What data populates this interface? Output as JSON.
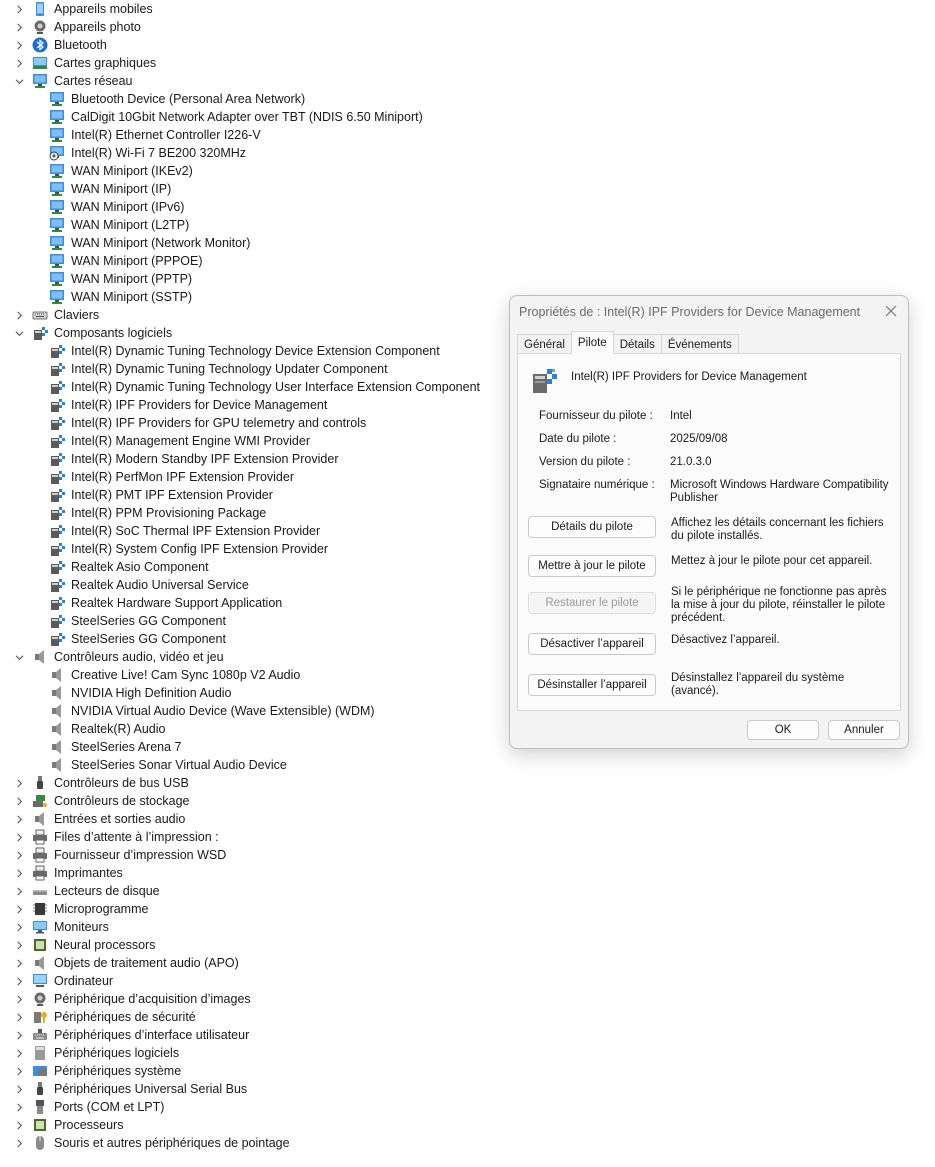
{
  "tree": [
    {
      "kind": "cat",
      "label": "Appareils mobiles",
      "icon": "mobile-icon",
      "expanded": false
    },
    {
      "kind": "cat",
      "label": "Appareils photo",
      "icon": "camera-icon",
      "expanded": false
    },
    {
      "kind": "cat",
      "label": "Bluetooth",
      "icon": "bluetooth-icon",
      "expanded": false
    },
    {
      "kind": "cat",
      "label": "Cartes graphiques",
      "icon": "display-adapter-icon",
      "expanded": false
    },
    {
      "kind": "cat",
      "label": "Cartes réseau",
      "icon": "network-icon",
      "expanded": true
    },
    {
      "kind": "child",
      "label": "Bluetooth Device (Personal Area Network)",
      "icon": "network-icon"
    },
    {
      "kind": "child",
      "label": "CalDigit 10Gbit Network Adapter over TBT (NDIS 6.50 Miniport)",
      "icon": "network-icon"
    },
    {
      "kind": "child",
      "label": "Intel(R) Ethernet Controller I226-V",
      "icon": "network-icon"
    },
    {
      "kind": "child",
      "label": "Intel(R) Wi-Fi 7 BE200 320MHz",
      "icon": "network-disabled-icon"
    },
    {
      "kind": "child",
      "label": "WAN Miniport (IKEv2)",
      "icon": "network-icon"
    },
    {
      "kind": "child",
      "label": "WAN Miniport (IP)",
      "icon": "network-icon"
    },
    {
      "kind": "child",
      "label": "WAN Miniport (IPv6)",
      "icon": "network-icon"
    },
    {
      "kind": "child",
      "label": "WAN Miniport (L2TP)",
      "icon": "network-icon"
    },
    {
      "kind": "child",
      "label": "WAN Miniport (Network Monitor)",
      "icon": "network-icon"
    },
    {
      "kind": "child",
      "label": "WAN Miniport (PPPOE)",
      "icon": "network-icon"
    },
    {
      "kind": "child",
      "label": "WAN Miniport (PPTP)",
      "icon": "network-icon"
    },
    {
      "kind": "child",
      "label": "WAN Miniport (SSTP)",
      "icon": "network-icon"
    },
    {
      "kind": "cat",
      "label": "Claviers",
      "icon": "keyboard-icon",
      "expanded": false
    },
    {
      "kind": "cat",
      "label": "Composants logiciels",
      "icon": "software-component-icon",
      "expanded": true
    },
    {
      "kind": "child",
      "label": "Intel(R) Dynamic Tuning Technology Device Extension Component",
      "icon": "software-component-icon"
    },
    {
      "kind": "child",
      "label": "Intel(R) Dynamic Tuning Technology Updater Component",
      "icon": "software-component-icon"
    },
    {
      "kind": "child",
      "label": "Intel(R) Dynamic Tuning Technology User Interface Extension Component",
      "icon": "software-component-icon"
    },
    {
      "kind": "child",
      "label": "Intel(R) IPF Providers for Device Management",
      "icon": "software-component-icon"
    },
    {
      "kind": "child",
      "label": "Intel(R) IPF Providers for GPU telemetry and controls",
      "icon": "software-component-icon"
    },
    {
      "kind": "child",
      "label": "Intel(R) Management Engine WMI Provider",
      "icon": "software-component-icon"
    },
    {
      "kind": "child",
      "label": "Intel(R) Modern Standby IPF Extension Provider",
      "icon": "software-component-icon"
    },
    {
      "kind": "child",
      "label": "Intel(R) PerfMon IPF Extension Provider",
      "icon": "software-component-icon"
    },
    {
      "kind": "child",
      "label": "Intel(R) PMT IPF Extension Provider",
      "icon": "software-component-icon"
    },
    {
      "kind": "child",
      "label": "Intel(R) PPM Provisioning Package",
      "icon": "software-component-icon"
    },
    {
      "kind": "child",
      "label": "Intel(R) SoC Thermal IPF Extension Provider",
      "icon": "software-component-icon"
    },
    {
      "kind": "child",
      "label": "Intel(R) System Config IPF Extension Provider",
      "icon": "software-component-icon"
    },
    {
      "kind": "child",
      "label": "Realtek Asio Component",
      "icon": "software-component-icon"
    },
    {
      "kind": "child",
      "label": "Realtek Audio Universal Service",
      "icon": "software-component-icon"
    },
    {
      "kind": "child",
      "label": "Realtek Hardware Support Application",
      "icon": "software-component-icon"
    },
    {
      "kind": "child",
      "label": "SteelSeries GG Component",
      "icon": "software-component-icon"
    },
    {
      "kind": "child",
      "label": "SteelSeries GG Component",
      "icon": "software-component-icon"
    },
    {
      "kind": "cat",
      "label": "Contrôleurs audio, vidéo et jeu",
      "icon": "speaker-icon",
      "expanded": true
    },
    {
      "kind": "child",
      "label": "Creative Live! Cam Sync 1080p V2 Audio",
      "icon": "speaker-icon"
    },
    {
      "kind": "child",
      "label": "NVIDIA High Definition Audio",
      "icon": "speaker-icon"
    },
    {
      "kind": "child",
      "label": "NVIDIA Virtual Audio Device (Wave Extensible) (WDM)",
      "icon": "speaker-icon"
    },
    {
      "kind": "child",
      "label": "Realtek(R) Audio",
      "icon": "speaker-icon"
    },
    {
      "kind": "child",
      "label": "SteelSeries Arena 7",
      "icon": "speaker-icon"
    },
    {
      "kind": "child",
      "label": "SteelSeries Sonar Virtual Audio Device",
      "icon": "speaker-icon"
    },
    {
      "kind": "cat",
      "label": "Contrôleurs de bus USB",
      "icon": "usb-icon",
      "expanded": false
    },
    {
      "kind": "cat",
      "label": "Contrôleurs de stockage",
      "icon": "storage-controller-icon",
      "expanded": false
    },
    {
      "kind": "cat",
      "label": "Entrées et sorties audio",
      "icon": "speaker-icon",
      "expanded": false
    },
    {
      "kind": "cat",
      "label": "Files d’attente à l’impression :",
      "icon": "printer-icon",
      "expanded": false
    },
    {
      "kind": "cat",
      "label": "Fournisseur d’impression WSD",
      "icon": "printer-icon",
      "expanded": false
    },
    {
      "kind": "cat",
      "label": "Imprimantes",
      "icon": "printer-icon",
      "expanded": false
    },
    {
      "kind": "cat",
      "label": "Lecteurs de disque",
      "icon": "disk-drive-icon",
      "expanded": false
    },
    {
      "kind": "cat",
      "label": "Microprogramme",
      "icon": "firmware-icon",
      "expanded": false
    },
    {
      "kind": "cat",
      "label": "Moniteurs",
      "icon": "monitor-icon",
      "expanded": false
    },
    {
      "kind": "cat",
      "label": "Neural processors",
      "icon": "chip-icon",
      "expanded": false
    },
    {
      "kind": "cat",
      "label": "Objets de traitement audio (APO)",
      "icon": "speaker-icon",
      "expanded": false
    },
    {
      "kind": "cat",
      "label": "Ordinateur",
      "icon": "computer-icon",
      "expanded": false
    },
    {
      "kind": "cat",
      "label": "Périphérique d’acquisition d’images",
      "icon": "camera-icon",
      "expanded": false
    },
    {
      "kind": "cat",
      "label": "Périphériques de sécurité",
      "icon": "security-key-icon",
      "expanded": false
    },
    {
      "kind": "cat",
      "label": "Périphériques d’interface utilisateur",
      "icon": "hid-icon",
      "expanded": false
    },
    {
      "kind": "cat",
      "label": "Périphériques logiciels",
      "icon": "software-device-icon",
      "expanded": false
    },
    {
      "kind": "cat",
      "label": "Périphériques système",
      "icon": "system-device-icon",
      "expanded": false
    },
    {
      "kind": "cat",
      "label": "Périphériques Universal Serial Bus",
      "icon": "usb-icon",
      "expanded": false
    },
    {
      "kind": "cat",
      "label": "Ports (COM et LPT)",
      "icon": "port-icon",
      "expanded": false
    },
    {
      "kind": "cat",
      "label": "Processeurs",
      "icon": "chip-icon",
      "expanded": false
    },
    {
      "kind": "cat",
      "label": "Souris et autres périphériques de pointage",
      "icon": "mouse-icon",
      "expanded": false
    }
  ],
  "dialog": {
    "title": "Propriétés de : Intel(R) IPF Providers for Device Management",
    "tabs": [
      {
        "label": "Général",
        "active": false
      },
      {
        "label": "Pilote",
        "active": true
      },
      {
        "label": "Détails",
        "active": false
      },
      {
        "label": "Événements",
        "active": false
      }
    ],
    "device_name": "Intel(R) IPF Providers for Device Management",
    "props": [
      {
        "key": "Fournisseur du pilote :",
        "value": "Intel"
      },
      {
        "key": "Date du pilote :",
        "value": "2025/09/08"
      },
      {
        "key": "Version du pilote :",
        "value": "21.0.3.0"
      },
      {
        "key": "Signataire numérique :",
        "value": "Microsoft Windows Hardware Compatibility Publisher"
      }
    ],
    "actions": [
      {
        "label": "Détails du pilote",
        "desc": "Affichez les détails concernant les fichiers du pilote installés.",
        "enabled": true
      },
      {
        "label": "Mettre à jour le pilote",
        "desc": "Mettez à jour le pilote pour cet appareil.",
        "enabled": true
      },
      {
        "label": "Restaurer le pilote",
        "desc": "Si le périphérique ne fonctionne pas après la mise à jour du pilote, réinstaller le pilote précédent.",
        "enabled": false
      },
      {
        "label": "Désactiver l’appareil",
        "desc": "Désactivez l’appareil.",
        "enabled": true
      },
      {
        "label": "Désinstaller l’appareil",
        "desc": "Désinstallez l’appareil du système (avancé).",
        "enabled": true
      }
    ],
    "ok_label": "OK",
    "cancel_label": "Annuler"
  },
  "colors": {
    "accent": "#2b7fd6",
    "monitor": "#3a8ee0",
    "grey_icon": "#5a5a5a"
  }
}
